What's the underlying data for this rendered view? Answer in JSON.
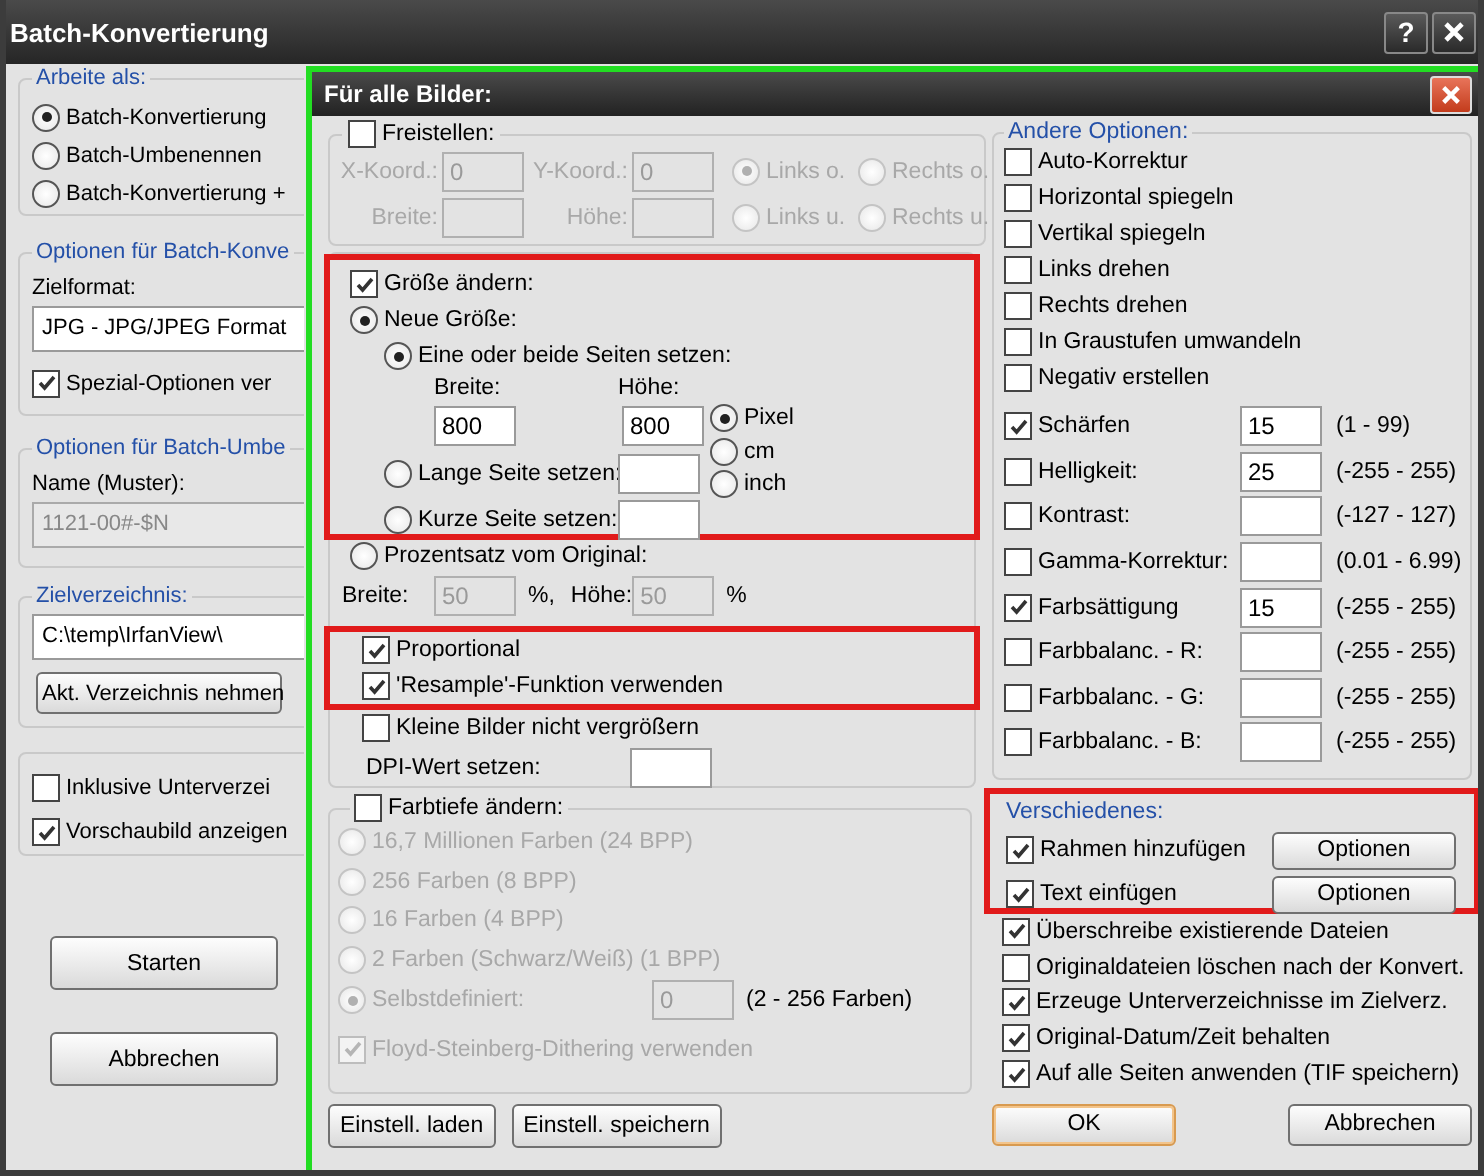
{
  "window": {
    "title": "Batch-Konvertierung",
    "help": "?"
  },
  "left_panel": {
    "work_as": {
      "title": "Arbeite als:",
      "options": [
        {
          "label": "Batch-Konvertierung",
          "selected": true
        },
        {
          "label": "Batch-Umbenennen",
          "selected": false
        },
        {
          "label": "Batch-Konvertierung +",
          "selected": false
        }
      ]
    },
    "conversion": {
      "title": "Optionen für Batch-Konve",
      "format_label": "Zielformat:",
      "format_value": "JPG - JPG/JPEG Format",
      "special": {
        "label": "Spezial-Optionen ver",
        "checked": true
      }
    },
    "rename": {
      "title": "Optionen für Batch-Umbe",
      "name_label": "Name (Muster):",
      "name_value": "1121-00#-$N"
    },
    "target": {
      "title": "Zielverzeichnis:",
      "path": "C:\\temp\\IrfanView\\",
      "button": "Akt. Verzeichnis nehmen"
    },
    "options": [
      {
        "label": "Inklusive Unterverzei",
        "checked": false
      },
      {
        "label": "Vorschaubild anzeigen",
        "checked": true
      }
    ],
    "buttons": [
      "Starten",
      "Abbrechen"
    ]
  },
  "dialog": {
    "title": "Für alle Bilder:",
    "highlighted": true,
    "crop": {
      "label": "Freistellen:",
      "checked": false,
      "x_label": "X-Koord.:",
      "x_value": "0",
      "y_label": "Y-Koord.:",
      "y_value": "0",
      "width_label": "Breite:",
      "height_label": "Höhe:",
      "corners": [
        {
          "label": "Links o.",
          "selected": true
        },
        {
          "label": "Rechts o.",
          "selected": false
        },
        {
          "label": "Links u.",
          "selected": false
        },
        {
          "label": "Rechts u.",
          "selected": false
        }
      ]
    },
    "resize": {
      "label": "Größe ändern:",
      "checked": true,
      "highlighted": true,
      "new_size": {
        "label": "Neue Größe:",
        "selected": true
      },
      "both": {
        "label": "Eine oder beide Seiten setzen:",
        "selected": true,
        "width_label": "Breite:",
        "width_value": "800",
        "height_label": "Höhe:",
        "height_value": "800"
      },
      "sides": [
        {
          "label": "Lange Seite setzen:",
          "selected": false
        },
        {
          "label": "Kurze Seite setzen:",
          "selected": false
        }
      ],
      "units": [
        {
          "label": "Pixel",
          "selected": true
        },
        {
          "label": "cm",
          "selected": false
        },
        {
          "label": "inch",
          "selected": false
        }
      ]
    },
    "percent": {
      "label": "Prozentsatz vom Original:",
      "selected": false,
      "width_label": "Breite:",
      "width_value": "50",
      "width_unit": "%,",
      "height_label": "Höhe:",
      "height_value": "50",
      "height_unit": "%"
    },
    "resize_flags": {
      "highlighted": true,
      "items": [
        {
          "label": "Proportional",
          "checked": true
        },
        {
          "label": "'Resample'-Funktion verwenden",
          "checked": true
        }
      ]
    },
    "small_images": {
      "label": "Kleine Bilder nicht vergrößern",
      "checked": false
    },
    "dpi": {
      "label": "DPI-Wert setzen:"
    },
    "color_depth": {
      "label": "Farbtiefe ändern:",
      "checked": false,
      "options": [
        {
          "label": "16,7 Millionen Farben (24 BPP)",
          "selected": false
        },
        {
          "label": "256 Farben (8 BPP)",
          "selected": false
        },
        {
          "label": "16 Farben (4 BPP)",
          "selected": false
        },
        {
          "label": "2 Farben (Schwarz/Weiß) (1 BPP)",
          "selected": false
        },
        {
          "label": "Selbstdefiniert:",
          "selected": true,
          "value": "0",
          "range": "(2 - 256 Farben)"
        }
      ],
      "dithering": {
        "label": "Floyd-Steinberg-Dithering verwenden",
        "checked": true
      }
    },
    "settings_buttons": [
      "Einstell. laden",
      "Einstell. speichern"
    ],
    "other": {
      "title": "Andere Optionen:",
      "items": [
        {
          "kind": "check",
          "label": "Auto-Korrektur",
          "checked": false
        },
        {
          "kind": "check",
          "label": "Horizontal spiegeln",
          "checked": false
        },
        {
          "kind": "check",
          "label": "Vertikal spiegeln",
          "checked": false
        },
        {
          "kind": "check",
          "label": "Links drehen",
          "checked": false
        },
        {
          "kind": "check",
          "label": "Rechts drehen",
          "checked": false
        },
        {
          "kind": "check",
          "label": "In Graustufen umwandeln",
          "checked": false
        },
        {
          "kind": "check",
          "label": "Negativ erstellen",
          "checked": false
        },
        {
          "kind": "value",
          "label": "Schärfen",
          "checked": true,
          "value": "15",
          "range": "(1 - 99)"
        },
        {
          "kind": "value",
          "label": "Helligkeit:",
          "checked": false,
          "value": "25",
          "range": "(-255 - 255)"
        },
        {
          "kind": "value",
          "label": "Kontrast:",
          "checked": false,
          "range": "(-127 - 127)"
        },
        {
          "kind": "value",
          "label": "Gamma-Korrektur:",
          "checked": false,
          "range": "(0.01 - 6.99)"
        },
        {
          "kind": "value",
          "label": "Farbsättigung",
          "checked": true,
          "value": "15",
          "range": "(-255 - 255)"
        },
        {
          "kind": "value",
          "label": "Farbbalanc. - R:",
          "checked": false,
          "range": "(-255 - 255)"
        },
        {
          "kind": "value",
          "label": "Farbbalanc. - G:",
          "checked": false,
          "range": "(-255 - 255)"
        },
        {
          "kind": "value",
          "label": "Farbbalanc. - B:",
          "checked": false,
          "range": "(-255 - 255)"
        }
      ]
    },
    "misc": {
      "title": "Verschiedenes:",
      "highlighted": true,
      "items": [
        {
          "label": "Rahmen hinzufügen",
          "checked": true,
          "button": "Optionen"
        },
        {
          "label": "Text einfügen",
          "checked": true,
          "button": "Optionen"
        }
      ]
    },
    "more": [
      {
        "label": "Überschreibe existierende Dateien",
        "checked": true
      },
      {
        "label": "Originaldateien löschen nach der Konvert.",
        "checked": false
      },
      {
        "label": "Erzeuge Unterverzeichnisse im Zielverz.",
        "checked": true
      },
      {
        "label": "Original-Datum/Zeit behalten",
        "checked": true
      },
      {
        "label": "Auf alle Seiten anwenden (TIF speichern)",
        "checked": true
      }
    ],
    "buttons": [
      {
        "label": "OK",
        "default": true
      },
      {
        "label": "Abbrechen",
        "default": false
      }
    ]
  }
}
